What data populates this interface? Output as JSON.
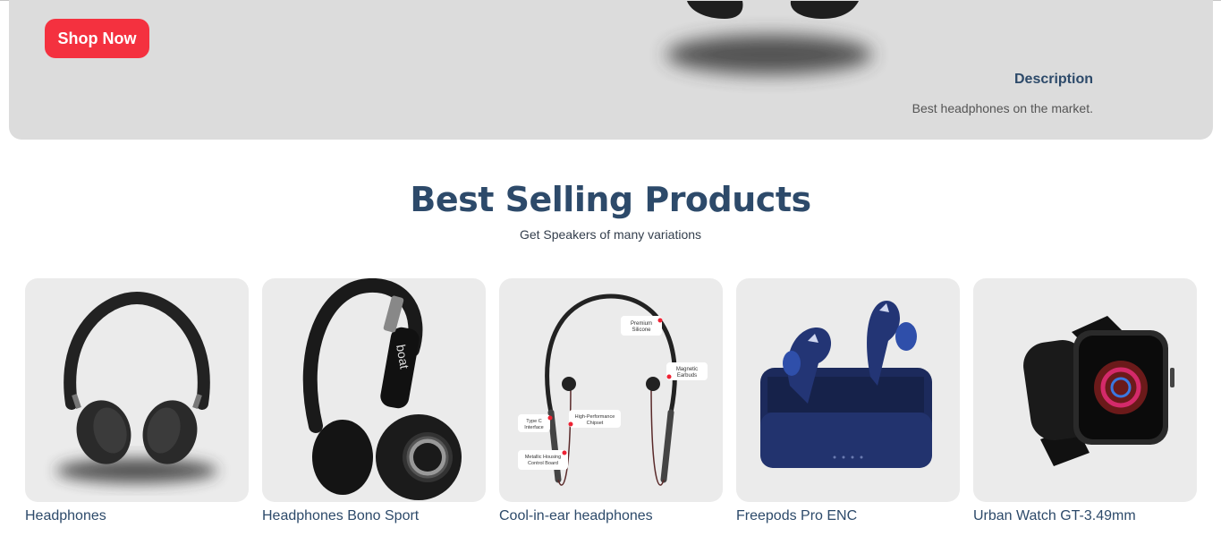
{
  "hero": {
    "shop_button": "Shop Now",
    "description_title": "Description",
    "description_text": "Best headphones on the market."
  },
  "section": {
    "title": "Best Selling Products",
    "subtitle": "Get Speakers of many variations"
  },
  "products": [
    {
      "name": "Headphones",
      "image": "over-ear-headphones-icon"
    },
    {
      "name": "Headphones Bono Sport",
      "image": "sport-headphones-icon"
    },
    {
      "name": "Cool-in-ear headphones",
      "image": "neckband-earphones-icon"
    },
    {
      "name": "Freepods Pro ENC",
      "image": "wireless-earbuds-icon"
    },
    {
      "name": "Urban Watch GT-3.49mm",
      "image": "smartwatch-icon"
    }
  ],
  "colors": {
    "accent": "#f4313f",
    "heading": "#2d4a6a",
    "hero_bg": "#dcdcdc",
    "card_bg": "#ebebeb"
  }
}
